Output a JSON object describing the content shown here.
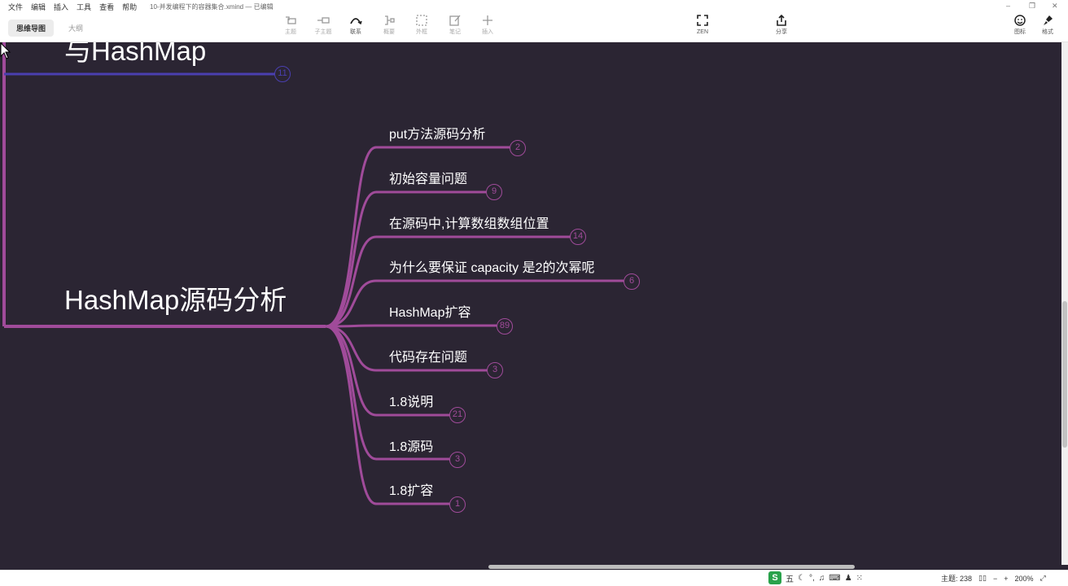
{
  "menu": [
    "文件",
    "编辑",
    "插入",
    "工具",
    "查看",
    "帮助"
  ],
  "document_title": "10-并发编程下的容器集合.xmind — 已编辑",
  "view_tabs": {
    "mindmap": "思维导图",
    "outline": "大纲"
  },
  "toolbar": {
    "topic": "主题",
    "subtopic": "子主题",
    "relationship": "联系",
    "summary": "概要",
    "boundary": "外框",
    "note": "笔记",
    "insert": "插入",
    "zen": "ZEN",
    "share": "分享",
    "icon": "图标",
    "format": "格式"
  },
  "mindmap": {
    "previous_topic": {
      "title": "与HashMap",
      "badge": "11"
    },
    "main_topic": "HashMap源码分析",
    "subtopics": [
      {
        "label": "put方法源码分析",
        "count": "2"
      },
      {
        "label": "初始容量问题",
        "count": "9"
      },
      {
        "label": "在源码中,计算数组数组位置",
        "count": "14"
      },
      {
        "label": "为什么要保证 capacity 是2的次幂呢",
        "count": "6"
      },
      {
        "label": "HashMap扩容",
        "count": "89"
      },
      {
        "label": "代码存在问题",
        "count": "3"
      },
      {
        "label": "1.8说明",
        "count": "21"
      },
      {
        "label": "1.8源码",
        "count": "3"
      },
      {
        "label": "1.8扩容",
        "count": "1"
      }
    ]
  },
  "statusbar": {
    "ime_mode": "五",
    "topic_count": "主题: 238",
    "zoom": "200%"
  },
  "colors": {
    "canvas": "#2b2533",
    "branch": "#a04b9a",
    "prev_branch": "#4a3fb0"
  }
}
